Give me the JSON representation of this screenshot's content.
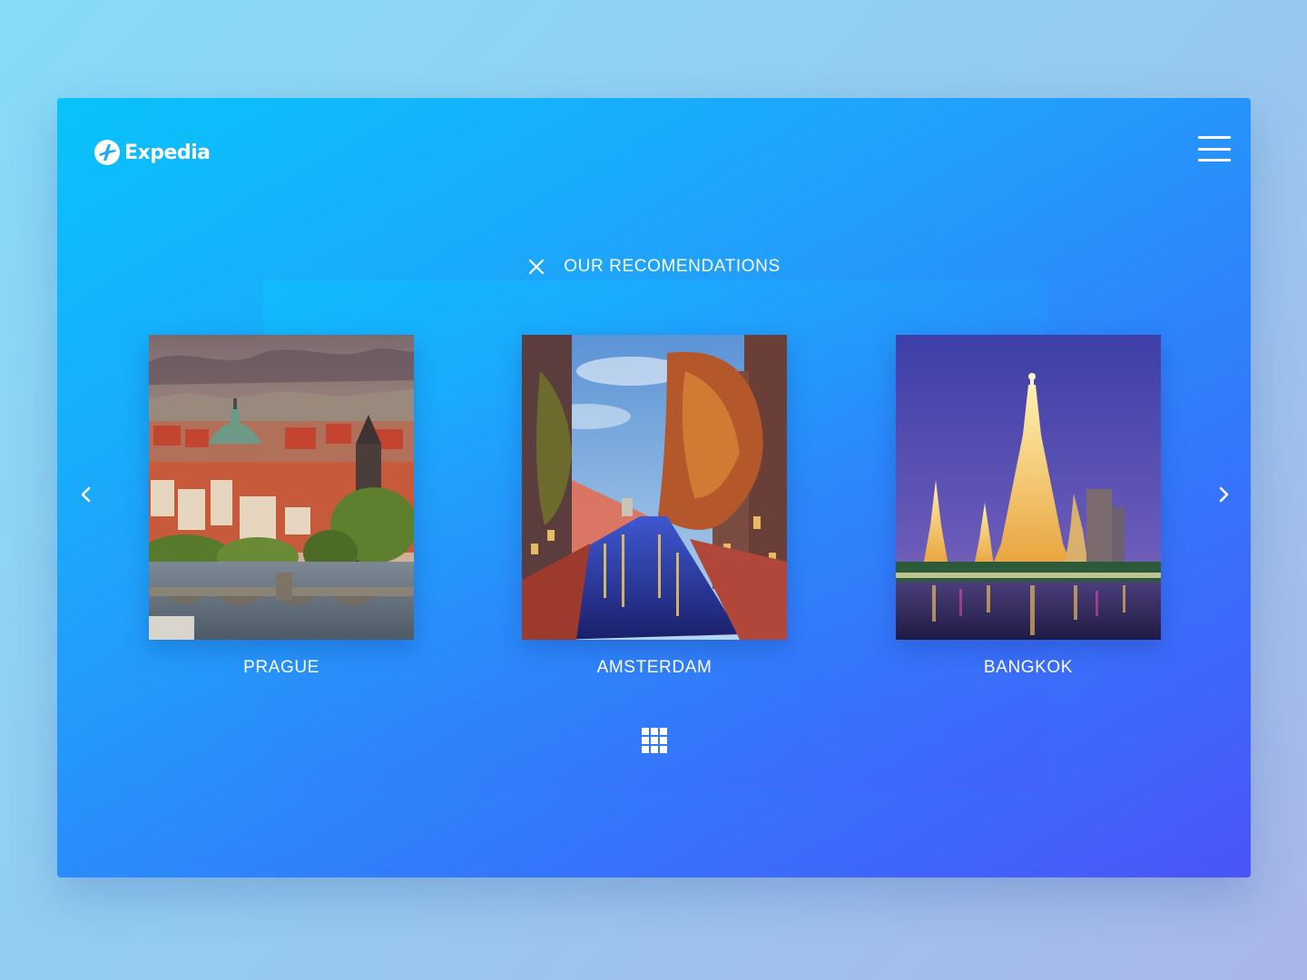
{
  "brand": {
    "logo_text": "Expedia",
    "logo_icon": "expedia-plane-logo"
  },
  "header": {
    "menu_icon": "hamburger-menu-icon",
    "close_icon": "close-icon",
    "title": "OUR RECOMENDATIONS"
  },
  "destinations": [
    {
      "label": "PRAGUE",
      "image": "prague-cityscape-photo"
    },
    {
      "label": "AMSTERDAM",
      "image": "amsterdam-canal-night-photo"
    },
    {
      "label": "BANGKOK",
      "image": "bangkok-wat-arun-night-photo"
    }
  ],
  "carousel": {
    "prev_icon": "chevron-left-icon",
    "next_icon": "chevron-right-icon",
    "grid_icon": "grid-view-icon"
  },
  "colors": {
    "app_gradient_start": "#08c3fb",
    "app_gradient_end": "#4a55f8",
    "page_background": "#97c9ef",
    "text": "#ffffff"
  }
}
